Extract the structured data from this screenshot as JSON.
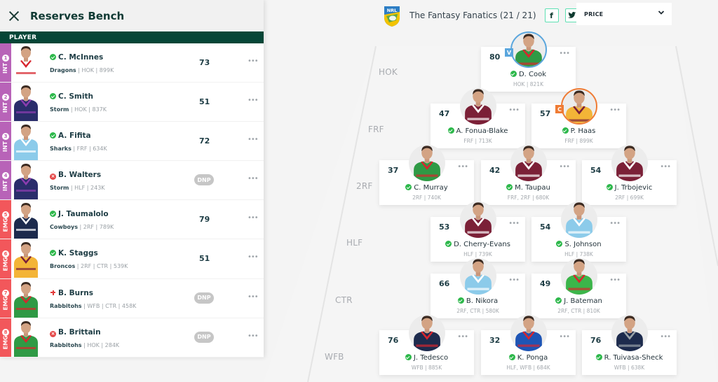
{
  "bench": {
    "title": "Reserves Bench",
    "column_header": "PLAYER",
    "players": [
      {
        "slot_type": "INT",
        "slot_num": "1",
        "status": "playing",
        "name": "C. McInnes",
        "team": "Dragons",
        "meta": "HOK | 899K",
        "score": "73",
        "jersey": "#ffffff",
        "trim": "#d7262e"
      },
      {
        "slot_type": "INT",
        "slot_num": "2",
        "status": "playing",
        "name": "C. Smith",
        "team": "Storm",
        "meta": "HOK | 837K",
        "score": "51",
        "jersey": "#2a2d6b",
        "trim": "#8d3db0"
      },
      {
        "slot_type": "INT",
        "slot_num": "3",
        "status": "playing",
        "name": "A. Fifita",
        "team": "Sharks",
        "meta": "FRF | 634K",
        "score": "72",
        "jersey": "#8ccbea",
        "trim": "#ffffff"
      },
      {
        "slot_type": "INT",
        "slot_num": "4",
        "status": "out",
        "name": "B. Walters",
        "team": "Storm",
        "meta": "HLF | 243K",
        "score": "DNP",
        "jersey": "#2a2d6b",
        "trim": "#8d3db0"
      },
      {
        "slot_type": "EMG",
        "slot_num": "5",
        "status": "playing",
        "name": "J. Taumalolo",
        "team": "Cowboys",
        "meta": "2RF | 789K",
        "score": "79",
        "jersey": "#1d2b4d",
        "trim": "#ffffff"
      },
      {
        "slot_type": "EMG",
        "slot_num": "6",
        "status": "playing",
        "name": "K. Staggs",
        "team": "Broncos",
        "meta": "2RF | CTR | 539K",
        "score": "51",
        "jersey": "#f3b437",
        "trim": "#7a1f3a"
      },
      {
        "slot_type": "EMG",
        "slot_num": "7",
        "status": "injured",
        "name": "B. Burns",
        "team": "Rabbitohs",
        "meta": "WFB | CTR | 458K",
        "score": "DNP",
        "jersey": "#2f9a45",
        "trim": "#d7262e"
      },
      {
        "slot_type": "EMG",
        "slot_num": "8",
        "status": "out",
        "name": "B. Brittain",
        "team": "Rabbitohs",
        "meta": "HOK | 284K",
        "score": "DNP",
        "jersey": "#2f9a45",
        "trim": "#d7262e"
      }
    ],
    "more_label": "•••"
  },
  "header": {
    "logo_text": "NRL",
    "team_name": "The Fantasy Fanatics (21 / 21)",
    "facebook_label": "f",
    "twitter_label": "t",
    "sort_label": "PRICE"
  },
  "field": {
    "positions": [
      "HOK",
      "FRF",
      "2RF",
      "HLF",
      "CTR",
      "WFB"
    ],
    "players": [
      {
        "name": "D. Cook",
        "meta": "HOK | 821K",
        "score": "80",
        "role": "V",
        "jersey": "#2f9a45",
        "trim": "#d7262e"
      },
      {
        "name": "A. Fonua-Blake",
        "meta": "FRF | 713K",
        "score": "47",
        "role": "",
        "jersey": "#7b2037",
        "trim": "#ffffff"
      },
      {
        "name": "P. Haas",
        "meta": "FRF | 899K",
        "score": "57",
        "role": "C",
        "jersey": "#f3b437",
        "trim": "#7a1f3a"
      },
      {
        "name": "C. Murray",
        "meta": "2RF | 740K",
        "score": "37",
        "role": "",
        "jersey": "#2f9a45",
        "trim": "#d7262e"
      },
      {
        "name": "M. Taupau",
        "meta": "FRF, 2RF | 680K",
        "score": "42",
        "role": "",
        "jersey": "#7b2037",
        "trim": "#ffffff"
      },
      {
        "name": "J. Trbojevic",
        "meta": "2RF | 699K",
        "score": "54",
        "role": "",
        "jersey": "#7b2037",
        "trim": "#ffffff"
      },
      {
        "name": "D. Cherry-Evans",
        "meta": "HLF | 739K",
        "score": "53",
        "role": "",
        "jersey": "#7b2037",
        "trim": "#ffffff"
      },
      {
        "name": "S. Johnson",
        "meta": "HLF | 738K",
        "score": "54",
        "role": "",
        "jersey": "#8ccbea",
        "trim": "#ffffff"
      },
      {
        "name": "B. Nikora",
        "meta": "2RF, CTR | 580K",
        "score": "66",
        "role": "",
        "jersey": "#8ccbea",
        "trim": "#ffffff"
      },
      {
        "name": "J. Bateman",
        "meta": "2RF, CTR | 810K",
        "score": "49",
        "role": "",
        "jersey": "#3cb54a",
        "trim": "#d7262e"
      },
      {
        "name": "J. Tedesco",
        "meta": "WFB | 885K",
        "score": "76",
        "role": "",
        "jersey": "#1d2b4d",
        "trim": "#d7262e"
      },
      {
        "name": "K. Ponga",
        "meta": "HLF, WFB | 684K",
        "score": "32",
        "role": "",
        "jersey": "#1e55b5",
        "trim": "#d7262e"
      },
      {
        "name": "R. Tuivasa-Sheck",
        "meta": "WFB | 638K",
        "score": "76",
        "role": "",
        "jersey": "#1d2b4d",
        "trim": "#9aa3a8"
      }
    ],
    "more_label": "•••"
  },
  "colors": {
    "int_slot": "#b863b8",
    "emg_slot": "#f2575b",
    "header_bar": "#064637",
    "vice_captain": "#5aa6dd",
    "captain": "#ef7b34",
    "playing": "#2db84b",
    "out": "#e44848"
  }
}
